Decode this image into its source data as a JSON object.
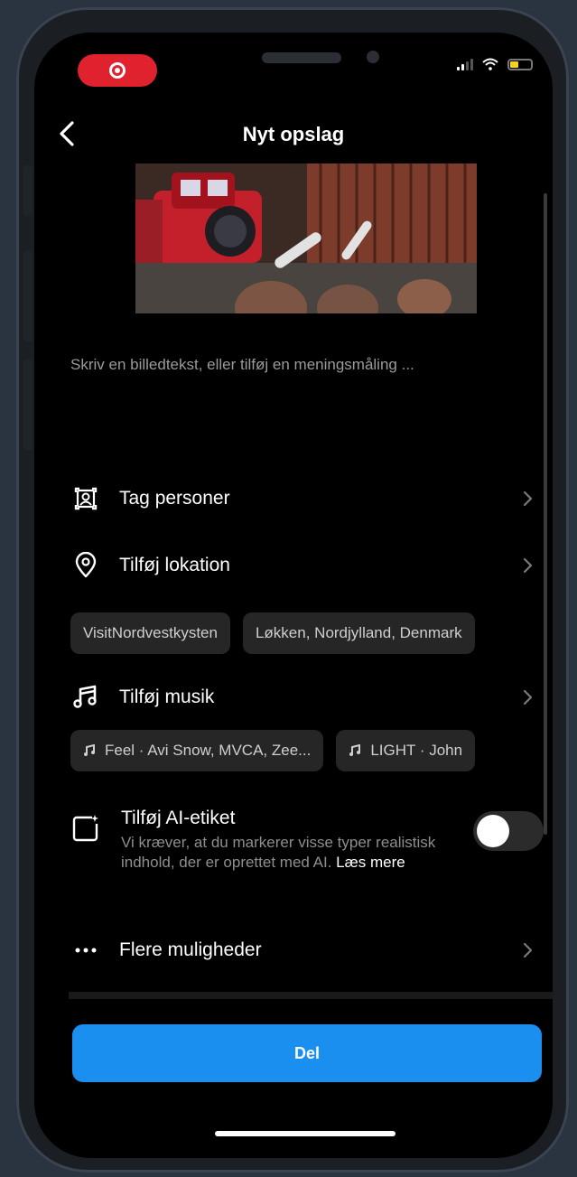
{
  "header": {
    "title": "Nyt opslag",
    "back_icon": "chevron-left-icon"
  },
  "status_bar": {
    "recording_indicator": "record-icon",
    "icons": [
      "signal-icon",
      "wifi-icon",
      "battery-icon"
    ]
  },
  "caption": {
    "placeholder": "Skriv en billedtekst, eller tilføj en meningsmåling ..."
  },
  "options": {
    "tag_people": {
      "label": "Tag personer",
      "icon": "tag-person-icon"
    },
    "add_location": {
      "label": "Tilføj lokation",
      "icon": "location-pin-icon"
    },
    "location_suggestions": [
      "VisitNordvestkysten",
      "Løkken, Nordjylland, Denmark"
    ],
    "add_music": {
      "label": "Tilføj musik",
      "icon": "music-note-icon"
    },
    "music_suggestions": [
      "Feel · Avi Snow, MVCA, Zee...",
      "LIGHT · John"
    ],
    "ai_label": {
      "title": "Tilføj AI-etiket",
      "description": "Vi kræver, at du markerer visse typer realistisk indhold, der er oprettet med AI.",
      "learn_more": "Læs mere",
      "enabled": false
    },
    "more_options": {
      "label": "Flere muligheder",
      "icon": "more-dots-icon"
    }
  },
  "actions": {
    "share_label": "Del"
  },
  "colors": {
    "accent": "#1a8ff0",
    "record": "#e0222f",
    "battery": "#f6d21b",
    "background": "#000000",
    "chip": "#262626"
  }
}
